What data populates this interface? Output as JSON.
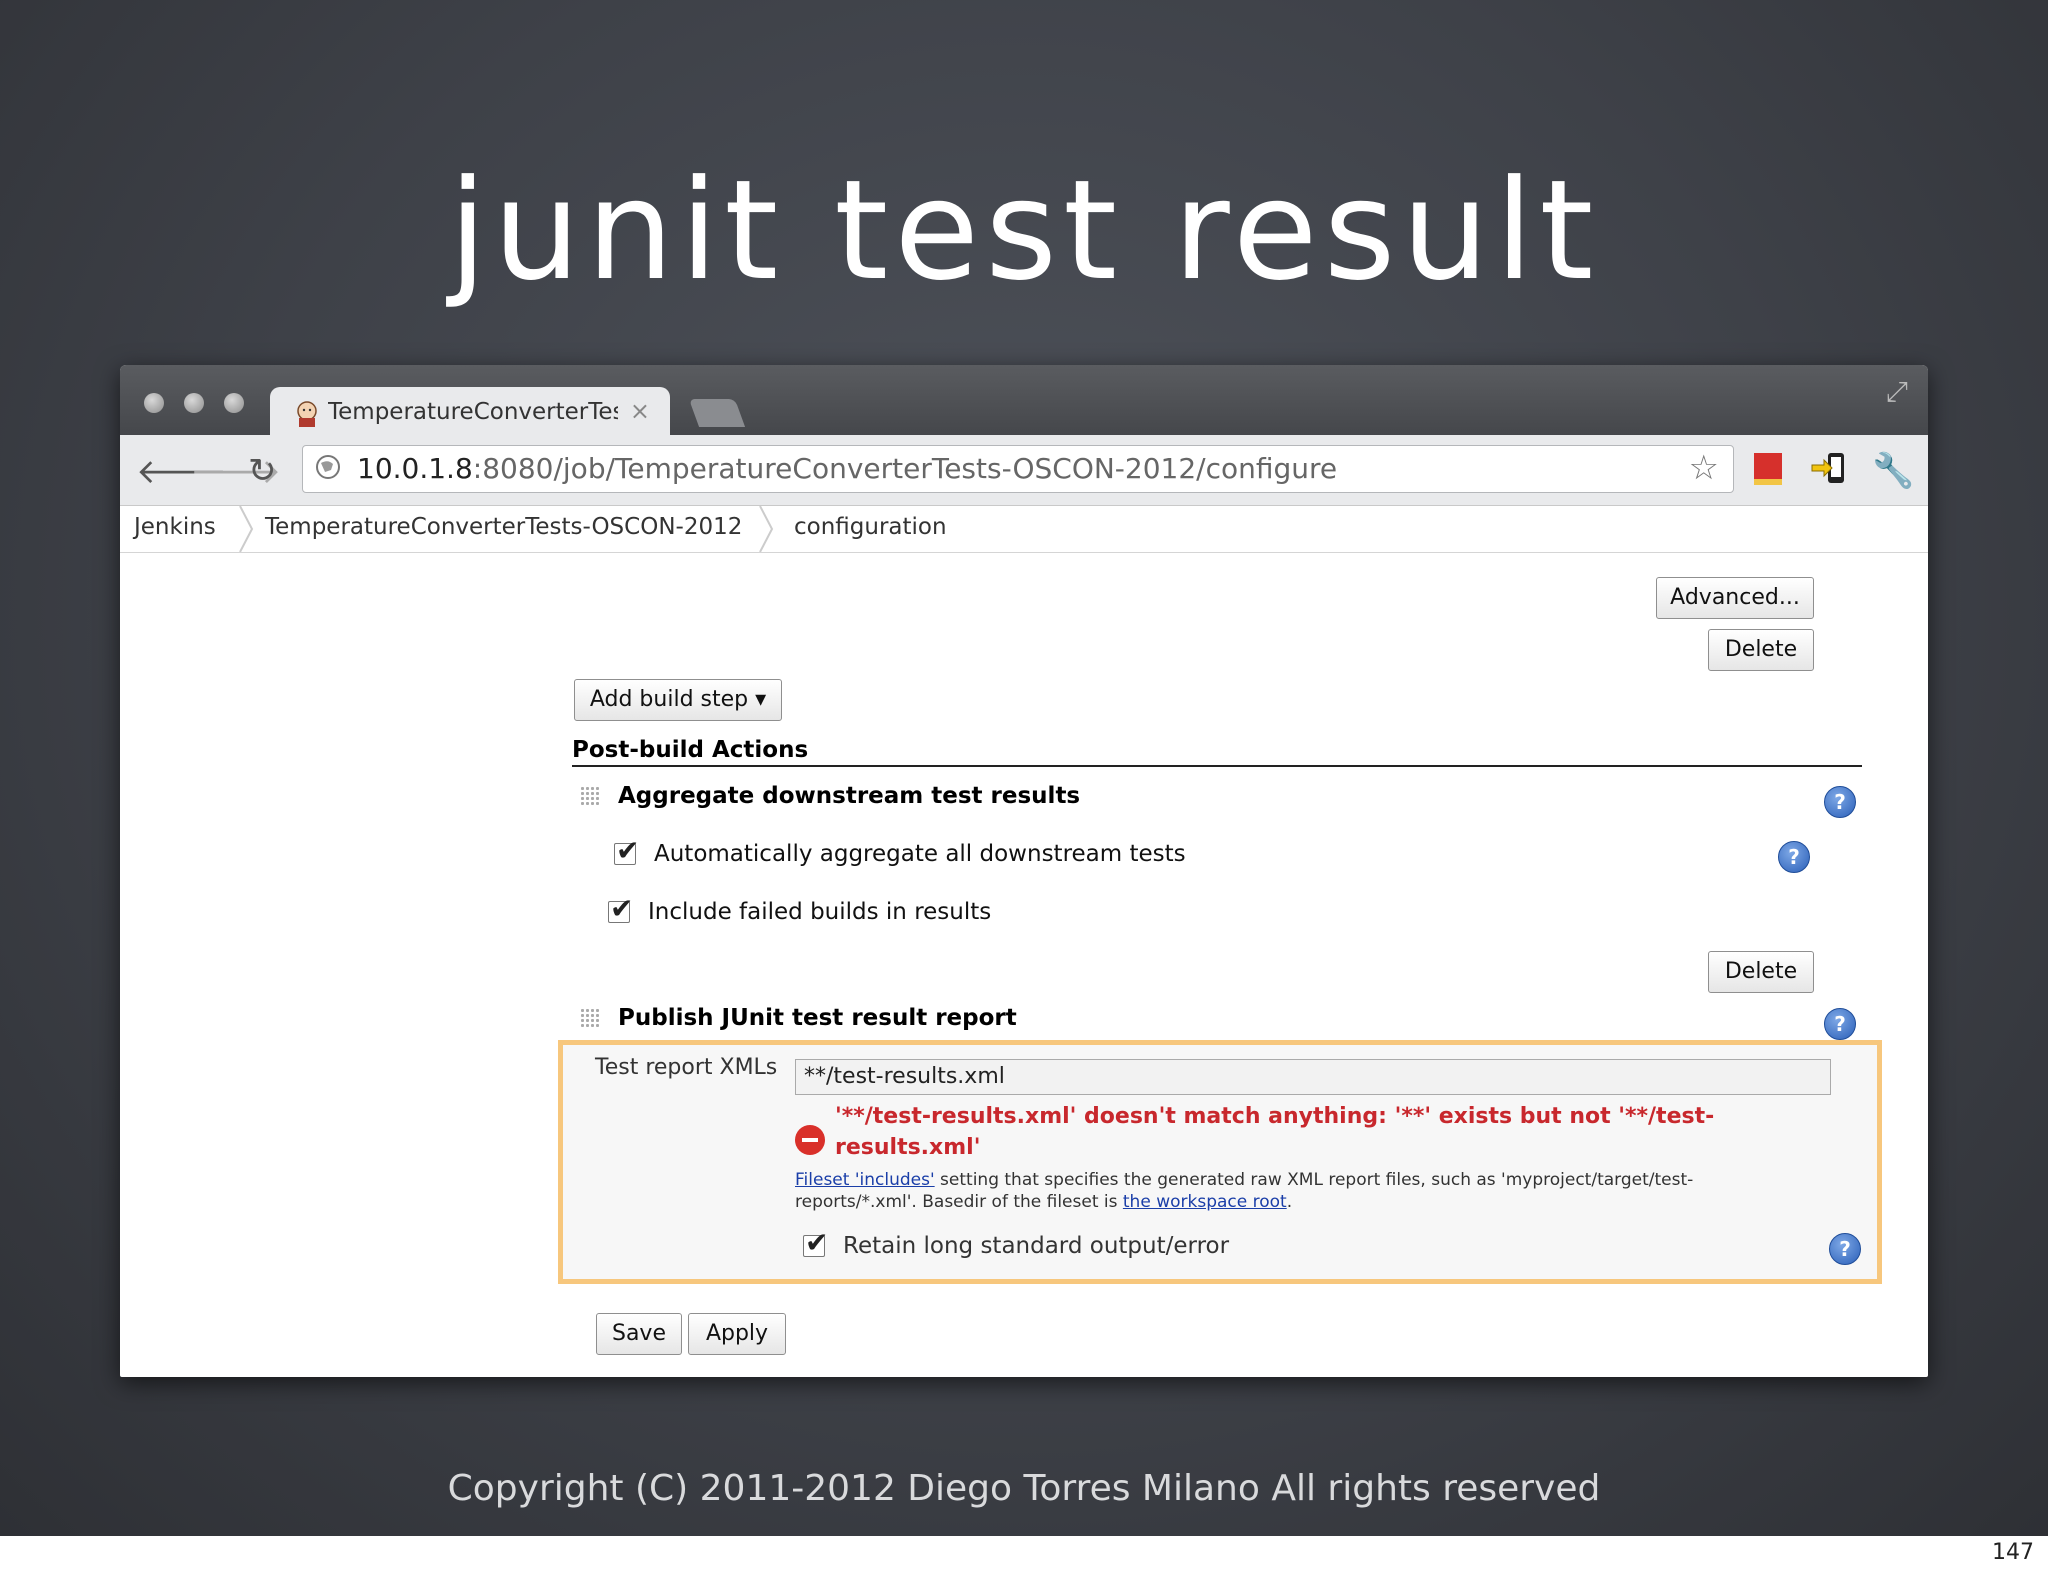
{
  "slide": {
    "title": "junit test result",
    "footer": "Copyright (C) 2011-2012   Diego Torres Milano   All rights reserved",
    "page_number": "147"
  },
  "browser": {
    "tab_title": "TemperatureConverterTests",
    "tab_close": "×",
    "url_host": "10.0.1.8",
    "url_rest": ":8080/job/TemperatureConverterTests-OSCON-2012/configure",
    "icons": [
      "back-icon",
      "forward-icon",
      "reload-icon",
      "globe-icon",
      "star-icon",
      "bookmark-extension-icon",
      "phone-extension-icon",
      "wrench-icon"
    ]
  },
  "breadcrumbs": [
    "Jenkins",
    "TemperatureConverterTests-OSCON-2012",
    "configuration"
  ],
  "buttons": {
    "advanced": "Advanced...",
    "delete1": "Delete",
    "add_build_step": "Add build step ▾",
    "delete2": "Delete",
    "save": "Save",
    "apply": "Apply"
  },
  "post_build": {
    "heading": "Post-build Actions",
    "aggregate": {
      "title": "Aggregate downstream test results",
      "auto_label": "Automatically aggregate all downstream tests",
      "auto_checked": true,
      "include_failed_label": "Include failed builds in results",
      "include_failed_checked": true
    },
    "junit": {
      "title": "Publish JUnit test result report",
      "field_label": "Test report XMLs",
      "field_value": "**/test-results.xml",
      "error_line1": "'**/test-results.xml' doesn't match anything: '**' exists but not '**/test-",
      "error_line2": "results.xml'",
      "help_link1": "Fileset 'includes'",
      "help_mid": " setting that specifies the generated raw XML report files, such as 'myproject/target/test-",
      "help_line2": "reports/*.xml'. Basedir of the fileset is ",
      "help_link2": "the workspace root",
      "help_end": ".",
      "retain_label": "Retain long standard output/error",
      "retain_checked": true
    }
  },
  "colors": {
    "highlight_border": "#f7c77d",
    "error_red": "#c8282d",
    "link_blue": "#1a3ea8"
  }
}
